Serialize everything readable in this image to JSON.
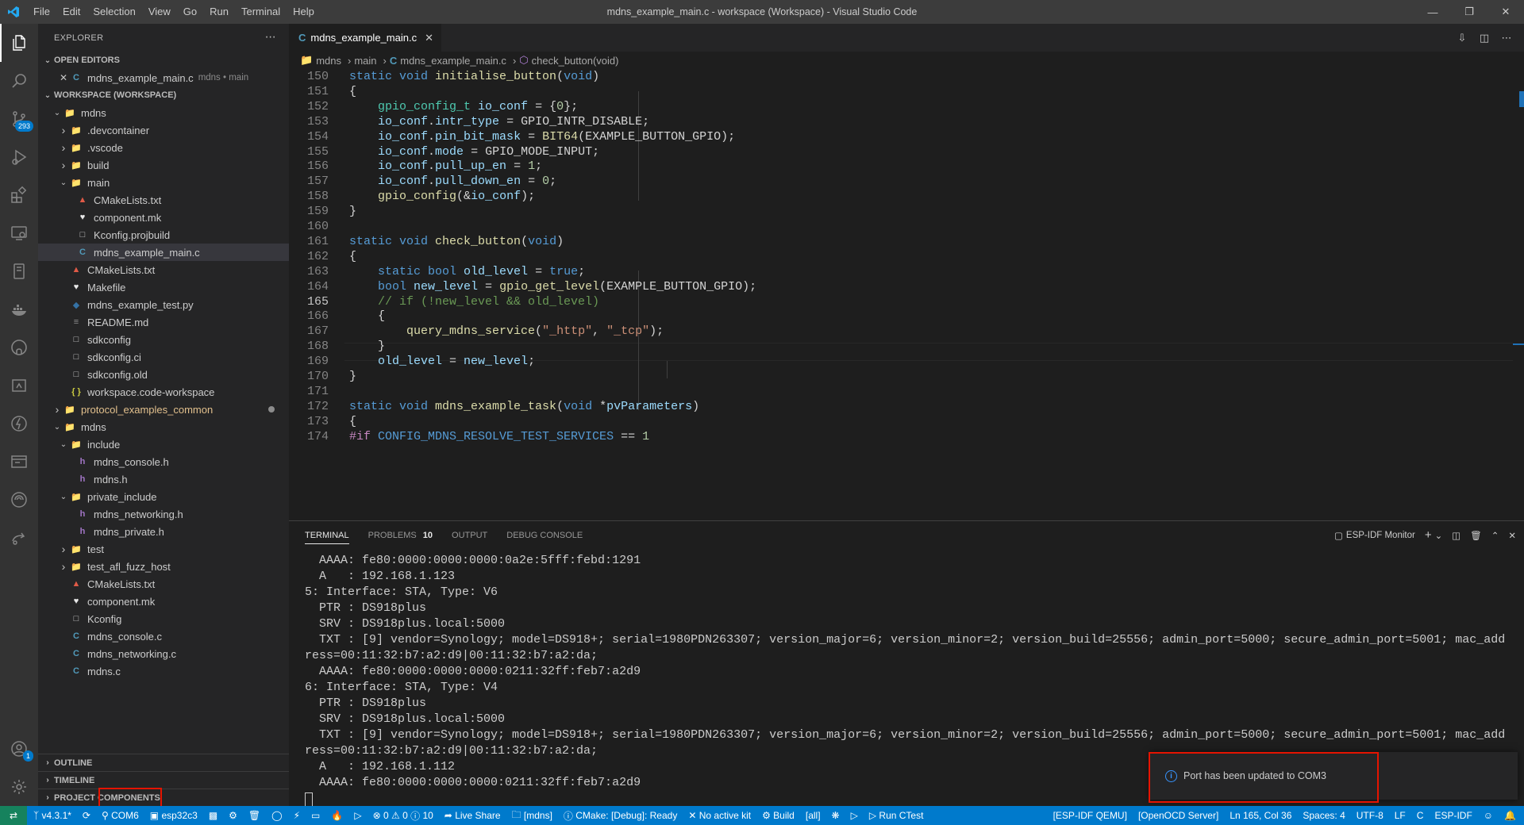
{
  "window": {
    "title": "mdns_example_main.c - workspace (Workspace) - Visual Studio Code",
    "menu": [
      "File",
      "Edit",
      "Selection",
      "View",
      "Go",
      "Run",
      "Terminal",
      "Help"
    ]
  },
  "activity": {
    "scm_badge": "293",
    "account_badge": "1"
  },
  "sidebar": {
    "header": "EXPLORER",
    "open_editors_label": "OPEN EDITORS",
    "open_editor": {
      "name": "mdns_example_main.c",
      "desc": "mdns • main"
    },
    "workspace_label": "WORKSPACE (WORKSPACE)",
    "tree": [
      {
        "label": "mdns",
        "depth": 1,
        "twisty": "open",
        "icon": "folder"
      },
      {
        "label": ".devcontainer",
        "depth": 2,
        "twisty": "closed",
        "icon": "folder-blue"
      },
      {
        "label": ".vscode",
        "depth": 2,
        "twisty": "closed",
        "icon": "folder-blue"
      },
      {
        "label": "build",
        "depth": 2,
        "twisty": "closed",
        "icon": "folder"
      },
      {
        "label": "main",
        "depth": 2,
        "twisty": "open",
        "icon": "folder"
      },
      {
        "label": "CMakeLists.txt",
        "depth": 3,
        "icon": "cmake"
      },
      {
        "label": "component.mk",
        "depth": 3,
        "icon": "make"
      },
      {
        "label": "Kconfig.projbuild",
        "depth": 3,
        "icon": "file"
      },
      {
        "label": "mdns_example_main.c",
        "depth": 3,
        "icon": "c",
        "selected": true
      },
      {
        "label": "CMakeLists.txt",
        "depth": 2,
        "icon": "cmake"
      },
      {
        "label": "Makefile",
        "depth": 2,
        "icon": "make"
      },
      {
        "label": "mdns_example_test.py",
        "depth": 2,
        "icon": "python"
      },
      {
        "label": "README.md",
        "depth": 2,
        "icon": "md"
      },
      {
        "label": "sdkconfig",
        "depth": 2,
        "icon": "file"
      },
      {
        "label": "sdkconfig.ci",
        "depth": 2,
        "icon": "file"
      },
      {
        "label": "sdkconfig.old",
        "depth": 2,
        "icon": "file"
      },
      {
        "label": "workspace.code-workspace",
        "depth": 2,
        "icon": "json"
      },
      {
        "label": "protocol_examples_common",
        "depth": 1,
        "twisty": "closed",
        "icon": "folder",
        "modified": true
      },
      {
        "label": "mdns",
        "depth": 1,
        "twisty": "open",
        "icon": "folder"
      },
      {
        "label": "include",
        "depth": 2,
        "twisty": "open",
        "icon": "folder-gray"
      },
      {
        "label": "mdns_console.h",
        "depth": 3,
        "icon": "h"
      },
      {
        "label": "mdns.h",
        "depth": 3,
        "icon": "h"
      },
      {
        "label": "private_include",
        "depth": 2,
        "twisty": "open",
        "icon": "folder"
      },
      {
        "label": "mdns_networking.h",
        "depth": 3,
        "icon": "h"
      },
      {
        "label": "mdns_private.h",
        "depth": 3,
        "icon": "h"
      },
      {
        "label": "test",
        "depth": 2,
        "twisty": "closed",
        "icon": "folder-red"
      },
      {
        "label": "test_afl_fuzz_host",
        "depth": 2,
        "twisty": "closed",
        "icon": "folder"
      },
      {
        "label": "CMakeLists.txt",
        "depth": 2,
        "icon": "cmake"
      },
      {
        "label": "component.mk",
        "depth": 2,
        "icon": "make"
      },
      {
        "label": "Kconfig",
        "depth": 2,
        "icon": "file"
      },
      {
        "label": "mdns_console.c",
        "depth": 2,
        "icon": "c"
      },
      {
        "label": "mdns_networking.c",
        "depth": 2,
        "icon": "c"
      },
      {
        "label": "mdns.c",
        "depth": 2,
        "icon": "c"
      }
    ],
    "outline_label": "OUTLINE",
    "timeline_label": "TIMELINE",
    "project_components_label": "PROJECT COMPONENTS"
  },
  "editor": {
    "tab_label": "mdns_example_main.c",
    "breadcrumb": [
      "mdns",
      "main",
      "mdns_example_main.c",
      "check_button(void)"
    ],
    "current_line": 165,
    "line_numbers": [
      "150",
      "151",
      "152",
      "153",
      "154",
      "155",
      "156",
      "157",
      "158",
      "159",
      "160",
      "161",
      "162",
      "163",
      "164",
      "165",
      "166",
      "167",
      "168",
      "169",
      "170",
      "171",
      "172",
      "173",
      "174"
    ],
    "lines": [
      [
        [
          "kw",
          "static "
        ],
        [
          "kw",
          "void "
        ],
        [
          "fn",
          "initialise_button"
        ],
        [
          "",
          "("
        ],
        [
          "kw",
          "void"
        ],
        [
          "",
          ")"
        ]
      ],
      [
        [
          "",
          "{"
        ]
      ],
      [
        [
          "",
          "    "
        ],
        [
          "ty",
          "gpio_config_t "
        ],
        [
          "va",
          "io_conf"
        ],
        [
          "",
          " = {"
        ],
        [
          "nm",
          "0"
        ],
        [
          "",
          "};"
        ]
      ],
      [
        [
          "",
          "    "
        ],
        [
          "va",
          "io_conf"
        ],
        [
          "",
          "."
        ],
        [
          "va",
          "intr_type"
        ],
        [
          "",
          " = GPIO_INTR_DISABLE;"
        ]
      ],
      [
        [
          "",
          "    "
        ],
        [
          "va",
          "io_conf"
        ],
        [
          "",
          "."
        ],
        [
          "va",
          "pin_bit_mask"
        ],
        [
          "",
          " = "
        ],
        [
          "fn",
          "BIT64"
        ],
        [
          "",
          "(EXAMPLE_BUTTON_GPIO);"
        ]
      ],
      [
        [
          "",
          "    "
        ],
        [
          "va",
          "io_conf"
        ],
        [
          "",
          "."
        ],
        [
          "va",
          "mode"
        ],
        [
          "",
          " = GPIO_MODE_INPUT;"
        ]
      ],
      [
        [
          "",
          "    "
        ],
        [
          "va",
          "io_conf"
        ],
        [
          "",
          "."
        ],
        [
          "va",
          "pull_up_en"
        ],
        [
          "",
          " = "
        ],
        [
          "nm",
          "1"
        ],
        [
          "",
          ";"
        ]
      ],
      [
        [
          "",
          "    "
        ],
        [
          "va",
          "io_conf"
        ],
        [
          "",
          "."
        ],
        [
          "va",
          "pull_down_en"
        ],
        [
          "",
          " = "
        ],
        [
          "nm",
          "0"
        ],
        [
          "",
          ";"
        ]
      ],
      [
        [
          "",
          "    "
        ],
        [
          "fn",
          "gpio_config"
        ],
        [
          "",
          "(&"
        ],
        [
          "va",
          "io_conf"
        ],
        [
          "",
          ");"
        ]
      ],
      [
        [
          "",
          "}"
        ]
      ],
      [
        [
          "",
          ""
        ]
      ],
      [
        [
          "kw",
          "static "
        ],
        [
          "kw",
          "void "
        ],
        [
          "fn",
          "check_button"
        ],
        [
          "",
          "("
        ],
        [
          "kw",
          "void"
        ],
        [
          "",
          ")"
        ]
      ],
      [
        [
          "",
          "{"
        ]
      ],
      [
        [
          "",
          "    "
        ],
        [
          "kw",
          "static "
        ],
        [
          "kw",
          "bool "
        ],
        [
          "va",
          "old_level"
        ],
        [
          "",
          " = "
        ],
        [
          "kw",
          "true"
        ],
        [
          "",
          ";"
        ]
      ],
      [
        [
          "",
          "    "
        ],
        [
          "kw",
          "bool "
        ],
        [
          "va",
          "new_level"
        ],
        [
          "",
          " = "
        ],
        [
          "fn",
          "gpio_get_level"
        ],
        [
          "",
          "(EXAMPLE_BUTTON_GPIO);"
        ]
      ],
      [
        [
          "",
          "    "
        ],
        [
          "cm",
          "// if (!new_level && old_level)"
        ]
      ],
      [
        [
          "",
          "    {"
        ]
      ],
      [
        [
          "",
          "        "
        ],
        [
          "fn",
          "query_mdns_service"
        ],
        [
          "",
          "("
        ],
        [
          "st",
          "\"_http\""
        ],
        [
          "",
          ", "
        ],
        [
          "st",
          "\"_tcp\""
        ],
        [
          "",
          ");"
        ]
      ],
      [
        [
          "",
          "    }"
        ]
      ],
      [
        [
          "",
          "    "
        ],
        [
          "va",
          "old_level"
        ],
        [
          "",
          " = "
        ],
        [
          "va",
          "new_level"
        ],
        [
          "",
          ";"
        ]
      ],
      [
        [
          "",
          "}"
        ]
      ],
      [
        [
          "",
          ""
        ]
      ],
      [
        [
          "kw",
          "static "
        ],
        [
          "kw",
          "void "
        ],
        [
          "fn",
          "mdns_example_task"
        ],
        [
          "",
          "("
        ],
        [
          "kw",
          "void "
        ],
        [
          "",
          "*"
        ],
        [
          "va",
          "pvParameters"
        ],
        [
          "",
          ")"
        ]
      ],
      [
        [
          "",
          "{"
        ]
      ],
      [
        [
          "ma",
          "#if "
        ],
        [
          "kw",
          "CONFIG_MDNS_RESOLVE_TEST_SERVICES"
        ],
        [
          "",
          " == "
        ],
        [
          "nm",
          "1"
        ]
      ]
    ]
  },
  "panel": {
    "tabs": [
      "TERMINAL",
      "PROBLEMS",
      "OUTPUT",
      "DEBUG CONSOLE"
    ],
    "problems_count": "10",
    "terminal_name": "ESP-IDF Monitor",
    "terminal_lines": [
      "  AAAA: fe80:0000:0000:0000:0a2e:5fff:febd:1291",
      "  A   : 192.168.1.123",
      "5: Interface: STA, Type: V6",
      "  PTR : DS918plus",
      "  SRV : DS918plus.local:5000",
      "  TXT : [9] vendor=Synology; model=DS918+; serial=1980PDN263307; version_major=6; version_minor=2; version_build=25556; admin_port=5000; secure_admin_port=5001; mac_add",
      "ress=00:11:32:b7:a2:d9|00:11:32:b7:a2:da;",
      "  AAAA: fe80:0000:0000:0000:0211:32ff:feb7:a2d9",
      "6: Interface: STA, Type: V4",
      "  PTR : DS918plus",
      "  SRV : DS918plus.local:5000",
      "  TXT : [9] vendor=Synology; model=DS918+; serial=1980PDN263307; version_major=6; version_minor=2; version_build=25556; admin_port=5000; secure_admin_port=5001; mac_add",
      "ress=00:11:32:b7:a2:d9|00:11:32:b7:a2:da;",
      "  A   : 192.168.1.112",
      "  AAAA: fe80:0000:0000:0000:0211:32ff:feb7:a2d9"
    ]
  },
  "notification": {
    "message": "Port has been updated to COM3"
  },
  "statusbar": {
    "branch": "v4.3.1*",
    "port": "COM6",
    "target": "esp32c3",
    "errors": "0",
    "warnings": "0",
    "infos": "10",
    "live_share": "Live Share",
    "project": "[mdns]",
    "cmake": "CMake: [Debug]: Ready",
    "kit": "No active kit",
    "build": "Build",
    "all": "[all]",
    "ctest": "Run CTest",
    "qemu": "[ESP-IDF QEMU]",
    "openocd": "[OpenOCD Server]",
    "position": "Ln 165, Col 36",
    "spaces": "Spaces: 4",
    "encoding": "UTF-8",
    "eol": "LF",
    "language": "C",
    "espidf": "ESP-IDF"
  },
  "colors": {
    "accent": "#007acc",
    "annotation_red": "#e51400"
  }
}
